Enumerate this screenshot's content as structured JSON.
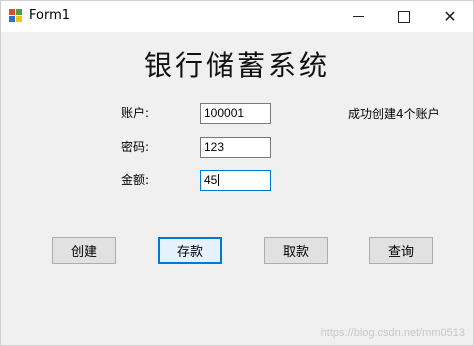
{
  "window": {
    "title": "Form1",
    "minimize_glyph": "",
    "close_glyph": "✕"
  },
  "form": {
    "heading": "银行储蓄系统",
    "account_label": "账户:",
    "account_value": "100001",
    "password_label": "密码:",
    "password_value": "123",
    "amount_label": "金额:",
    "amount_value": "45",
    "status_message": "成功创建4个账户"
  },
  "buttons": {
    "create": "创建",
    "deposit": "存款",
    "withdraw": "取款",
    "query": "查询"
  },
  "watermark": "https://blog.csdn.net/mm0513",
  "colors": {
    "window_bg": "#f0f0f0",
    "focus_border": "#0078d7",
    "button_bg": "#e1e1e1"
  }
}
